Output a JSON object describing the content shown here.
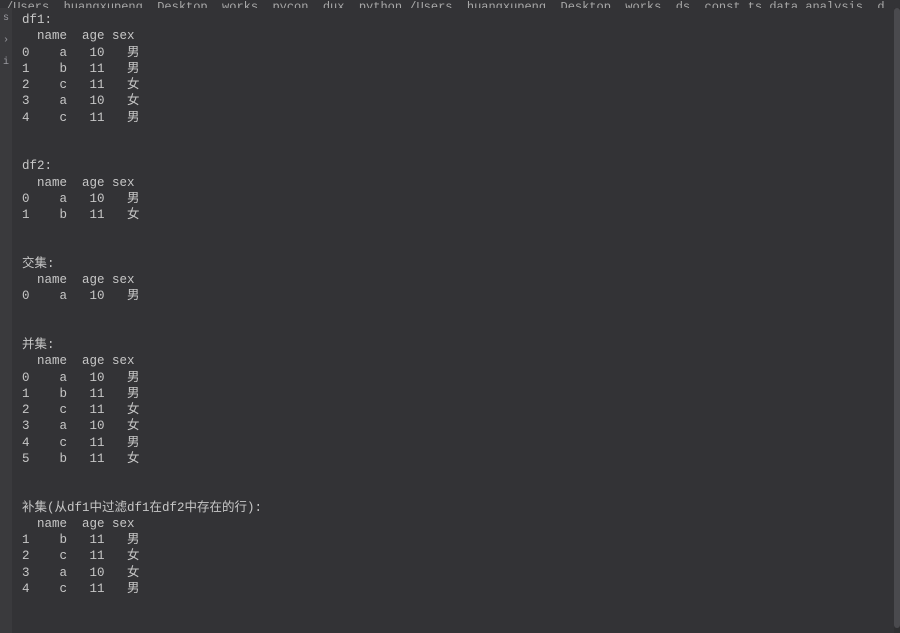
{
  "top_path": "/Users, huangxupeng, Desktop, works, pycon, dux, python  /Users, huangxupeng, Desktop, works, ds, const ts_data_analysis, d",
  "sidebar": {
    "glyph1": "s",
    "glyph2": "›",
    "glyph3": "i"
  },
  "sections": [
    {
      "label": "df1:",
      "columns": [
        "name",
        "age",
        "sex"
      ],
      "rows": [
        {
          "idx": "0",
          "name": "a",
          "age": "10",
          "sex": "男"
        },
        {
          "idx": "1",
          "name": "b",
          "age": "11",
          "sex": "男"
        },
        {
          "idx": "2",
          "name": "c",
          "age": "11",
          "sex": "女"
        },
        {
          "idx": "3",
          "name": "a",
          "age": "10",
          "sex": "女"
        },
        {
          "idx": "4",
          "name": "c",
          "age": "11",
          "sex": "男"
        }
      ]
    },
    {
      "label": "df2:",
      "columns": [
        "name",
        "age",
        "sex"
      ],
      "rows": [
        {
          "idx": "0",
          "name": "a",
          "age": "10",
          "sex": "男"
        },
        {
          "idx": "1",
          "name": "b",
          "age": "11",
          "sex": "女"
        }
      ]
    },
    {
      "label": "交集:",
      "columns": [
        "name",
        "age",
        "sex"
      ],
      "rows": [
        {
          "idx": "0",
          "name": "a",
          "age": "10",
          "sex": "男"
        }
      ]
    },
    {
      "label": "并集:",
      "columns": [
        "name",
        "age",
        "sex"
      ],
      "rows": [
        {
          "idx": "0",
          "name": "a",
          "age": "10",
          "sex": "男"
        },
        {
          "idx": "1",
          "name": "b",
          "age": "11",
          "sex": "男"
        },
        {
          "idx": "2",
          "name": "c",
          "age": "11",
          "sex": "女"
        },
        {
          "idx": "3",
          "name": "a",
          "age": "10",
          "sex": "女"
        },
        {
          "idx": "4",
          "name": "c",
          "age": "11",
          "sex": "男"
        },
        {
          "idx": "5",
          "name": "b",
          "age": "11",
          "sex": "女"
        }
      ]
    },
    {
      "label": "补集(从df1中过滤df1在df2中存在的行):",
      "columns": [
        "name",
        "age",
        "sex"
      ],
      "rows": [
        {
          "idx": "1",
          "name": "b",
          "age": "11",
          "sex": "男"
        },
        {
          "idx": "2",
          "name": "c",
          "age": "11",
          "sex": "女"
        },
        {
          "idx": "3",
          "name": "a",
          "age": "10",
          "sex": "女"
        },
        {
          "idx": "4",
          "name": "c",
          "age": "11",
          "sex": "男"
        }
      ]
    }
  ]
}
